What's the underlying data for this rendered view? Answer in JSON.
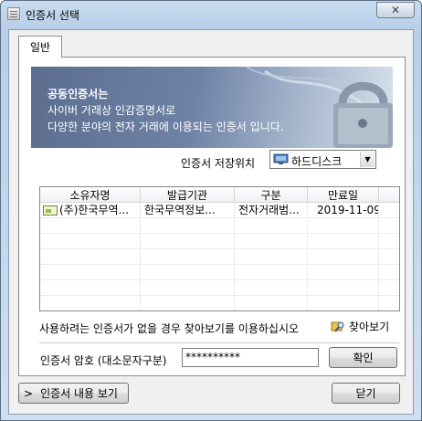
{
  "window": {
    "title": "인증서 선택",
    "close_symbol": "✕"
  },
  "tabs": [
    {
      "label": "일반"
    }
  ],
  "banner": {
    "title": "공동인증서는",
    "lines": [
      "사이버 거래상 인감증명서로",
      "다양한 분야의 전자 거래에 이용되는 인증서 입니다."
    ]
  },
  "location": {
    "label": "인증서 저장위치",
    "value": "하드디스크",
    "icon": "hard-disk-icon"
  },
  "table": {
    "columns": [
      "소유자명",
      "발급기관",
      "구분",
      "만료일"
    ],
    "rows": [
      {
        "owner": "(주)한국무역...",
        "issuer": "한국무역정보...",
        "type": "전자거래범...",
        "expiry": "2019-11-09"
      }
    ]
  },
  "hint": "사용하려는 인증서가 없을 경우 찾아보기를 이용하십시오",
  "browse": {
    "label": "찾아보기",
    "icon": "folder-search-icon"
  },
  "password": {
    "label": "인증서 암호 (대소문자구분)",
    "value": "**********"
  },
  "buttons": {
    "ok": "확인",
    "view_cert": "인증서 내용 보기",
    "view_prefix": ">",
    "close": "닫기"
  },
  "colors": {
    "banner": "#5b6e90",
    "title_bg": "#b7cfe8",
    "cert_icon": "#8fbf4f"
  }
}
